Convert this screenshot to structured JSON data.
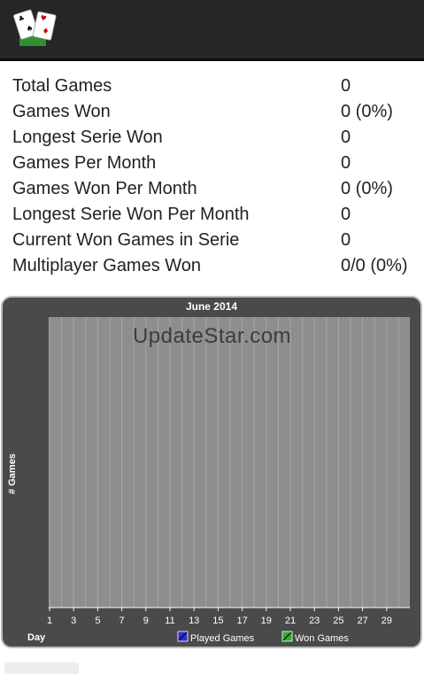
{
  "app": {
    "icon": "playing-cards-icon"
  },
  "stats": [
    {
      "label": "Total Games",
      "value": "0"
    },
    {
      "label": "Games Won",
      "value": "0 (0%)"
    },
    {
      "label": "Longest Serie Won",
      "value": "0"
    },
    {
      "label": "Games Per Month",
      "value": "0"
    },
    {
      "label": "Games Won Per Month",
      "value": "0 (0%)"
    },
    {
      "label": "Longest Serie Won Per Month",
      "value": "0"
    },
    {
      "label": "Current Won Games in Serie",
      "value": "0"
    },
    {
      "label": "Multiplayer Games Won",
      "value": "0/0 (0%)"
    }
  ],
  "watermark": "UpdateStar.com",
  "colors": {
    "topbar": "#262626",
    "chart_frame": "#4a4a4a",
    "plot_area": "#8e8e8e",
    "played": "#2b2bd6",
    "won": "#2fae2f"
  },
  "chart_data": {
    "type": "bar",
    "title": "June 2014",
    "xlabel": "Day",
    "ylabel": "# Games",
    "x": [
      1,
      2,
      3,
      4,
      5,
      6,
      7,
      8,
      9,
      10,
      11,
      12,
      13,
      14,
      15,
      16,
      17,
      18,
      19,
      20,
      21,
      22,
      23,
      24,
      25,
      26,
      27,
      28,
      29,
      30
    ],
    "xticks": [
      "1",
      "3",
      "5",
      "7",
      "9",
      "11",
      "13",
      "15",
      "17",
      "19",
      "21",
      "23",
      "25",
      "27",
      "29"
    ],
    "series": [
      {
        "name": "Played Games",
        "values": [
          0,
          0,
          0,
          0,
          0,
          0,
          0,
          0,
          0,
          0,
          0,
          0,
          0,
          0,
          0,
          0,
          0,
          0,
          0,
          0,
          0,
          0,
          0,
          0,
          0,
          0,
          0,
          0,
          0,
          0
        ]
      },
      {
        "name": "Won Games",
        "values": [
          0,
          0,
          0,
          0,
          0,
          0,
          0,
          0,
          0,
          0,
          0,
          0,
          0,
          0,
          0,
          0,
          0,
          0,
          0,
          0,
          0,
          0,
          0,
          0,
          0,
          0,
          0,
          0,
          0,
          0
        ]
      }
    ],
    "ylim": [
      0,
      1
    ],
    "grid": true,
    "legend": "bottom-center"
  }
}
